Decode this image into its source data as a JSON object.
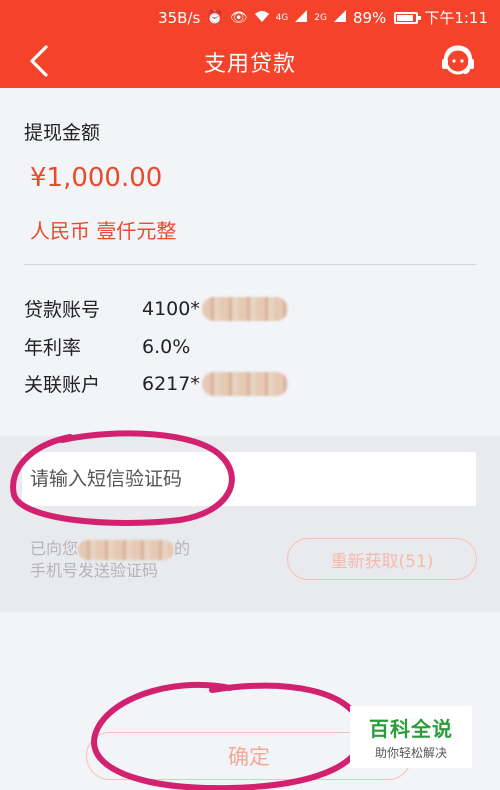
{
  "status_bar": {
    "speed": "35B/s",
    "signal_a": "4G",
    "signal_b": "2G",
    "battery": "89%",
    "time": "下午1:11"
  },
  "header": {
    "title": "支用贷款",
    "back_icon": "chevron-left-icon",
    "service_icon": "customer-service-icon"
  },
  "amount": {
    "label": "提现金额",
    "value": "¥1,000.00",
    "words": "人民币 壹仟元整"
  },
  "info": {
    "loan_account_label": "贷款账号",
    "loan_account_value": "4100*",
    "rate_label": "年利率",
    "rate_value": "6.0%",
    "linked_account_label": "关联账户",
    "linked_account_value": "6217*"
  },
  "verify": {
    "placeholder": "请输入短信验证码",
    "note_prefix": "已向您",
    "note_suffix": "的",
    "note_line2": "手机号发送验证码",
    "resend_label": "重新获取(51)"
  },
  "confirm": {
    "label": "确定"
  },
  "watermark": {
    "title": "百科全说",
    "subtitle": "助你轻松解决"
  },
  "colors": {
    "brand": "#f5422a",
    "accent_text": "#e94a2c",
    "annotation": "#d1216f",
    "watermark_green": "#2a9d3a"
  }
}
